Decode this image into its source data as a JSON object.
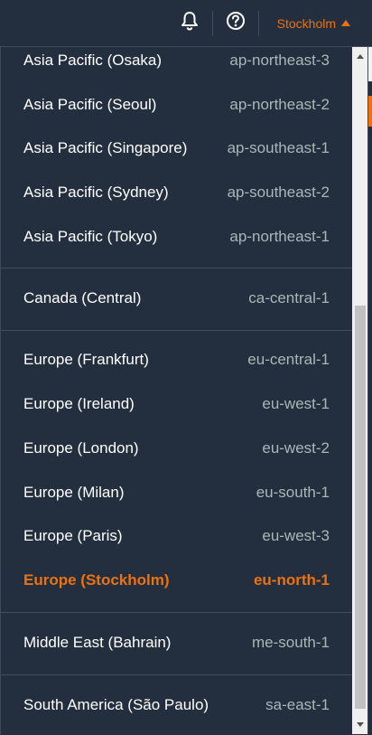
{
  "topbar": {
    "notifications_icon": "bell-icon",
    "help_icon": "question-circle-icon",
    "region_label": "Stockholm",
    "region_caret_icon": "caret-up-icon"
  },
  "regions": [
    {
      "name": "Asia Pacific (Osaka)",
      "code": "ap-northeast-3",
      "selected": false
    },
    {
      "name": "Asia Pacific (Seoul)",
      "code": "ap-northeast-2",
      "selected": false
    },
    {
      "name": "Asia Pacific (Singapore)",
      "code": "ap-southeast-1",
      "selected": false
    },
    {
      "name": "Asia Pacific (Sydney)",
      "code": "ap-southeast-2",
      "selected": false
    },
    {
      "name": "Asia Pacific (Tokyo)",
      "code": "ap-northeast-1",
      "selected": false
    },
    {
      "name": "Canada (Central)",
      "code": "ca-central-1",
      "selected": false
    },
    {
      "name": "Europe (Frankfurt)",
      "code": "eu-central-1",
      "selected": false
    },
    {
      "name": "Europe (Ireland)",
      "code": "eu-west-1",
      "selected": false
    },
    {
      "name": "Europe (London)",
      "code": "eu-west-2",
      "selected": false
    },
    {
      "name": "Europe (Milan)",
      "code": "eu-south-1",
      "selected": false
    },
    {
      "name": "Europe (Paris)",
      "code": "eu-west-3",
      "selected": false
    },
    {
      "name": "Europe (Stockholm)",
      "code": "eu-north-1",
      "selected": true
    },
    {
      "name": "Middle East (Bahrain)",
      "code": "me-south-1",
      "selected": false
    },
    {
      "name": "South America (São Paulo)",
      "code": "sa-east-1",
      "selected": false
    }
  ],
  "colors": {
    "background": "#232f3e",
    "accent": "#ec7211",
    "text": "#ffffff",
    "muted_text": "#aab7b8",
    "divider": "#414d5c"
  }
}
